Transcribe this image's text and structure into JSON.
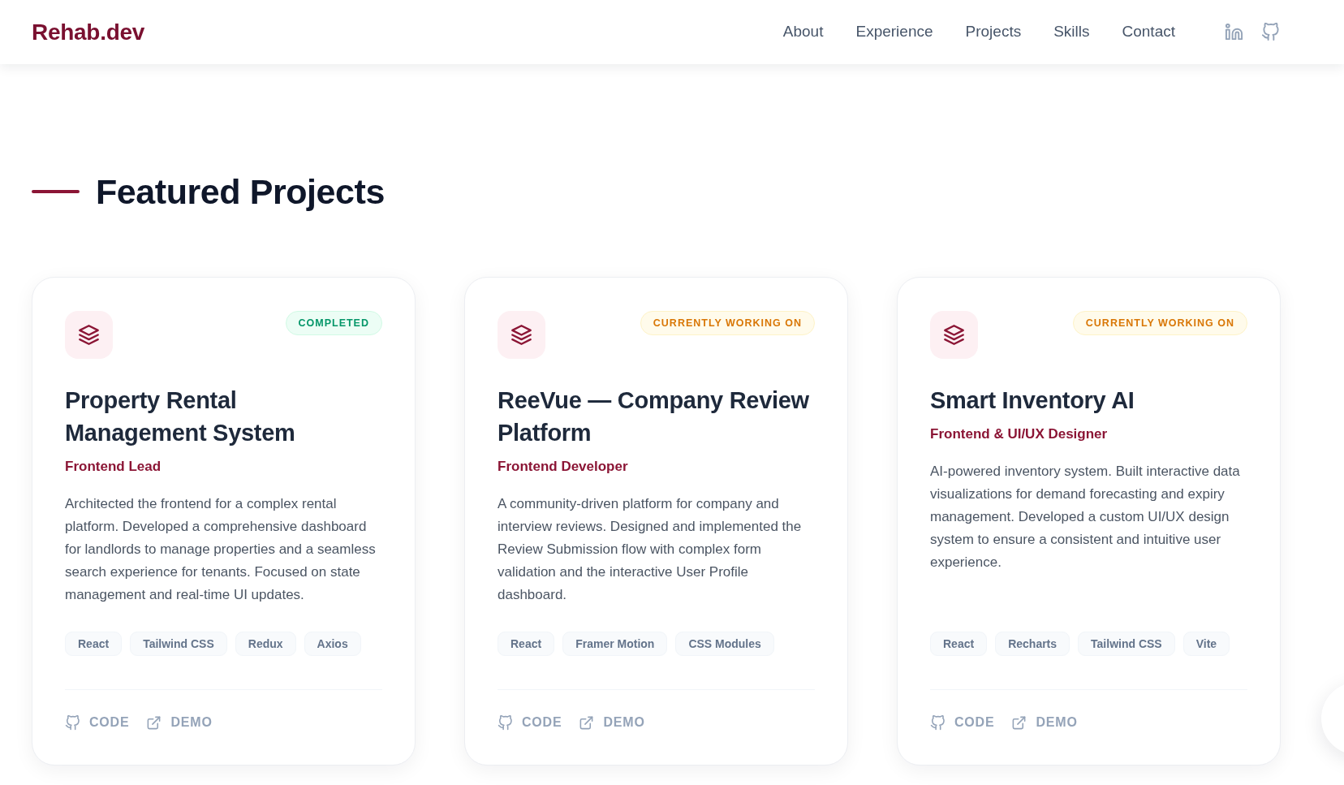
{
  "header": {
    "logo": "Rehab.dev",
    "nav": [
      {
        "label": "About"
      },
      {
        "label": "Experience"
      },
      {
        "label": "Projects"
      },
      {
        "label": "Skills"
      },
      {
        "label": "Contact"
      }
    ],
    "social": [
      {
        "kind": "linkedin"
      },
      {
        "kind": "github"
      }
    ]
  },
  "section": {
    "title": "Featured Projects"
  },
  "projects": [
    {
      "status": {
        "kind": "completed",
        "label": "COMPLETED"
      },
      "title": "Property Rental Management System",
      "role": "Frontend Lead",
      "description": "Architected the frontend for a complex rental platform. Developed a comprehensive dashboard for landlords to manage properties and a seamless search experience for tenants. Focused on state management and real-time UI updates.",
      "tags": [
        "React",
        "Tailwind CSS",
        "Redux",
        "Axios"
      ],
      "links": [
        {
          "kind": "code",
          "label": "CODE"
        },
        {
          "kind": "demo",
          "label": "DEMO"
        }
      ]
    },
    {
      "status": {
        "kind": "in_progress",
        "label": "CURRENTLY WORKING ON"
      },
      "title": "ReeVue — Company Review Platform",
      "role": "Frontend Developer",
      "description": "A community-driven platform for company and interview reviews. Designed and implemented the Review Submission flow with complex form validation and the interactive User Profile dashboard.",
      "tags": [
        "React",
        "Framer Motion",
        "CSS Modules"
      ],
      "links": [
        {
          "kind": "code",
          "label": "CODE"
        },
        {
          "kind": "demo",
          "label": "DEMO"
        }
      ]
    },
    {
      "status": {
        "kind": "in_progress",
        "label": "CURRENTLY WORKING ON"
      },
      "title": "Smart Inventory AI",
      "role": "Frontend & UI/UX Designer",
      "description": "AI-powered inventory system. Built interactive data visualizations for demand forecasting and expiry management. Developed a custom UI/UX design system to ensure a consistent and intuitive user experience.",
      "tags": [
        "React",
        "Recharts",
        "Tailwind CSS",
        "Vite"
      ],
      "links": [
        {
          "kind": "code",
          "label": "CODE"
        },
        {
          "kind": "demo",
          "label": "DEMO"
        }
      ]
    }
  ]
}
